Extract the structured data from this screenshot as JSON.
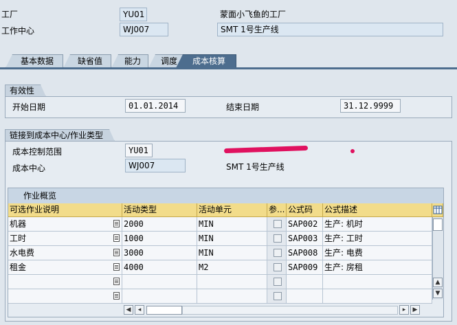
{
  "header": {
    "plant_label": "工厂",
    "plant_value": "YU01",
    "plant_desc": "蒙面小飞鱼的工厂",
    "workcenter_label": "工作中心",
    "workcenter_value": "WJ007",
    "workcenter_desc": "SMT 1号生产线"
  },
  "tabs": [
    {
      "label": "基本数据"
    },
    {
      "label": "缺省值"
    },
    {
      "label": "能力"
    },
    {
      "label": "调度"
    },
    {
      "label": "成本核算"
    }
  ],
  "validity": {
    "title": "有效性",
    "start_label": "开始日期",
    "start_value": "01.01.2014",
    "end_label": "结束日期",
    "end_value": "31.12.9999"
  },
  "link": {
    "title": "链接到成本中心/作业类型",
    "area_label": "成本控制范围",
    "area_value": "YU01",
    "cc_label": "成本中心",
    "cc_value": "WJ007",
    "cc_desc": "SMT 1号生产线"
  },
  "activities": {
    "title": "作业概览",
    "columns": [
      "可选作业说明",
      "活动类型",
      "活动单元",
      "参...",
      "公式码",
      "公式描述"
    ],
    "rows": [
      {
        "desc": "机器",
        "type": "2000",
        "unit": "MIN",
        "formula": "SAP002",
        "formula_desc": "生产: 机时"
      },
      {
        "desc": "工时",
        "type": "1000",
        "unit": "MIN",
        "formula": "SAP003",
        "formula_desc": "生产: 工时"
      },
      {
        "desc": "水电费",
        "type": "3000",
        "unit": "MIN",
        "formula": "SAP008",
        "formula_desc": "生产: 电费"
      },
      {
        "desc": "租金",
        "type": "4000",
        "unit": "M2",
        "formula": "SAP009",
        "formula_desc": "生产: 房租"
      },
      {
        "desc": "",
        "type": "",
        "unit": "",
        "formula": "",
        "formula_desc": ""
      },
      {
        "desc": "",
        "type": "",
        "unit": "",
        "formula": "",
        "formula_desc": ""
      }
    ]
  },
  "colors": {
    "tab_active": "#4d6d8e",
    "column_header": "#f2dc8a",
    "redaction": "#e0115f"
  },
  "icons": [
    "f4-help-icon",
    "table-settings-icon",
    "scroll-up-icon",
    "scroll-down-icon",
    "scroll-left-icon",
    "scroll-right-icon"
  ]
}
